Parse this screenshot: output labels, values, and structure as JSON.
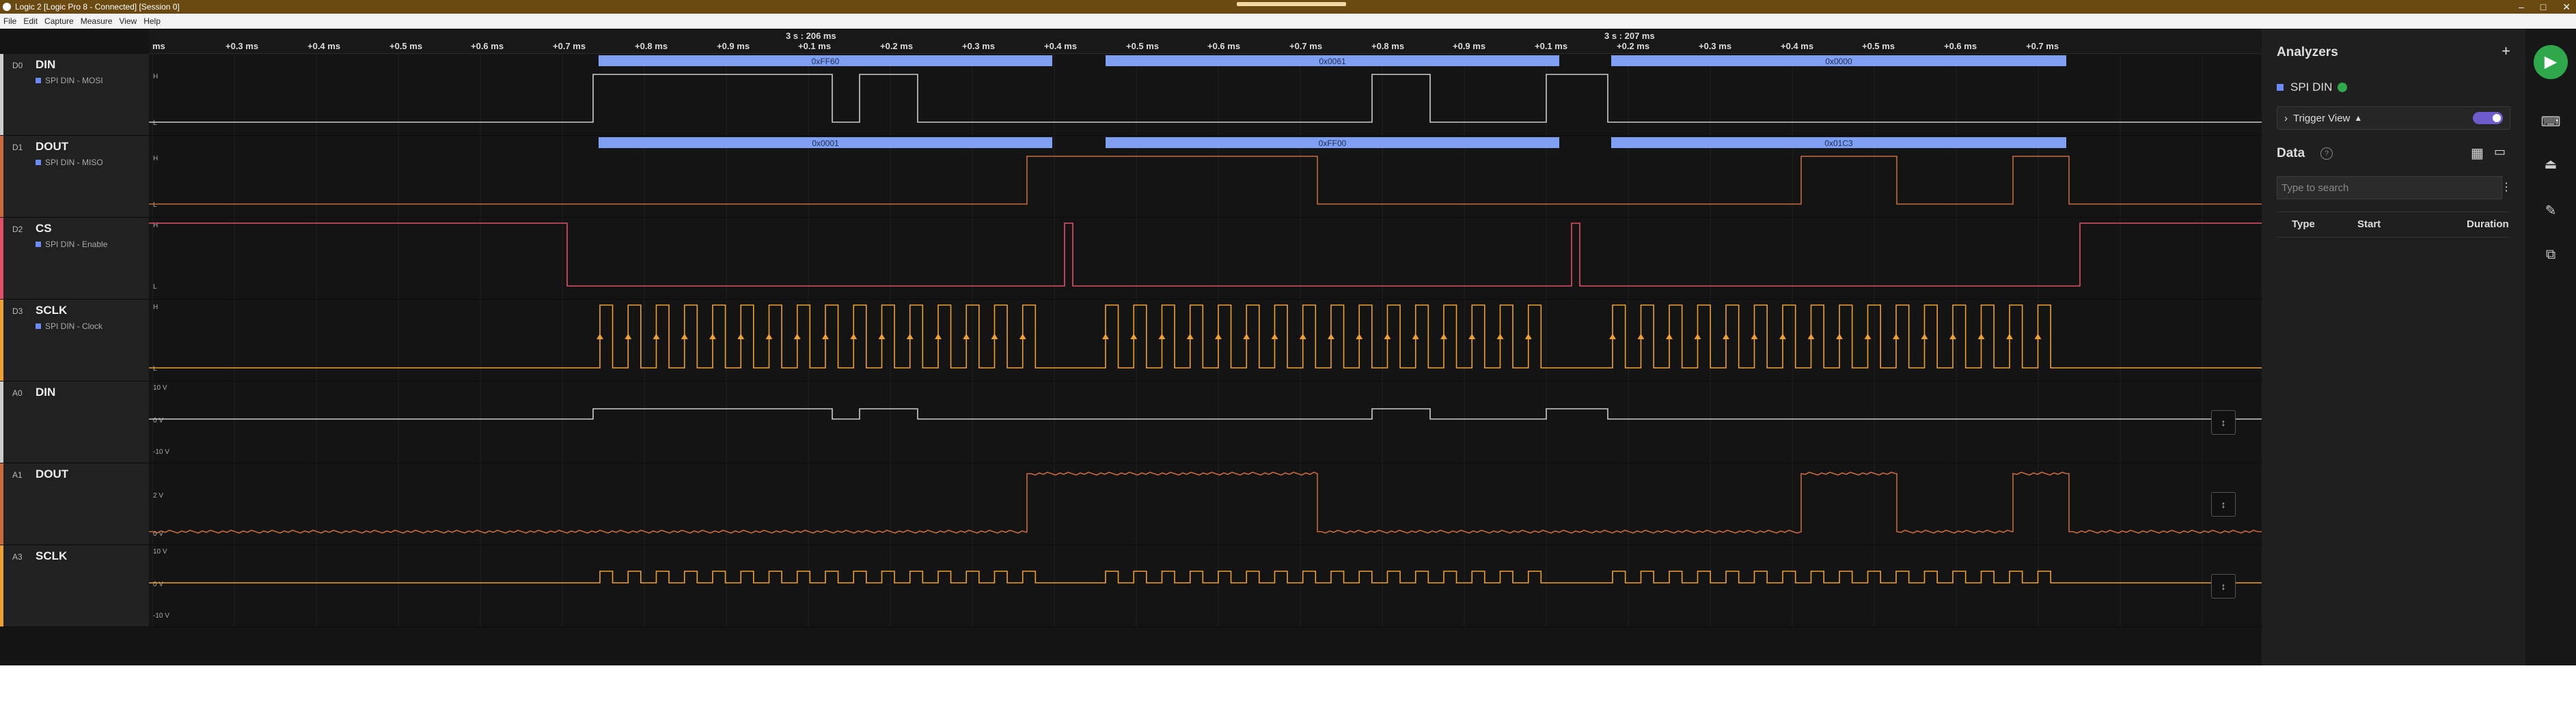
{
  "window": {
    "title": "Logic 2 [Logic Pro 8 - Connected] [Session 0]",
    "controls": [
      "–",
      "□",
      "✕"
    ]
  },
  "menu": [
    "File",
    "Edit",
    "Capture",
    "Measure",
    "View",
    "Help"
  ],
  "ruler": {
    "segment_labels": [
      "3 s : 206 ms",
      "3 s : 207 ms"
    ],
    "ticks": [
      "ms",
      "+0.3 ms",
      "+0.4 ms",
      "+0.5 ms",
      "+0.6 ms",
      "+0.7 ms",
      "+0.8 ms",
      "+0.9 ms",
      "+0.1 ms",
      "+0.2 ms",
      "+0.3 ms",
      "+0.4 ms",
      "+0.5 ms",
      "+0.6 ms",
      "+0.7 ms",
      "+0.8 ms",
      "+0.9 ms",
      "+0.1 ms",
      "+0.2 ms",
      "+0.3 ms",
      "+0.4 ms",
      "+0.5 ms",
      "+0.6 ms",
      "+0.7 ms"
    ]
  },
  "channels": [
    {
      "index": "D0",
      "name": "DIN",
      "analyzer": "SPI DIN - MOSI",
      "color": "#cccccc",
      "high": "H",
      "low": "L",
      "frames": [
        "0xFF60",
        "0x0061",
        "0x0000"
      ]
    },
    {
      "index": "D1",
      "name": "DOUT",
      "analyzer": "SPI DIN - MISO",
      "color": "#c86a3a",
      "high": "H",
      "low": "L",
      "frames": [
        "0x0001",
        "0xFF00",
        "0x01C3"
      ]
    },
    {
      "index": "D2",
      "name": "CS",
      "analyzer": "SPI DIN - Enable",
      "color": "#e0506a",
      "high": "H",
      "low": "L",
      "frames": []
    },
    {
      "index": "D3",
      "name": "SCLK",
      "analyzer": "SPI DIN - Clock",
      "color": "#f0a030",
      "high": "H",
      "low": "L",
      "frames": []
    },
    {
      "index": "A0",
      "name": "DIN",
      "analyzer": "",
      "color": "#cccccc",
      "scale": [
        "10 V",
        "0 V",
        "-10 V"
      ]
    },
    {
      "index": "A1",
      "name": "DOUT",
      "analyzer": "",
      "color": "#c86a3a",
      "scale": [
        "2 V",
        "0 V"
      ]
    },
    {
      "index": "A3",
      "name": "SCLK",
      "analyzer": "",
      "color": "#f0a030",
      "scale": [
        "10 V",
        "0 V",
        "-10 V"
      ]
    }
  ],
  "sidebar": {
    "title": "Analyzers",
    "add": "+",
    "analyzer_name": "SPI DIN",
    "trigger_view": "Trigger View",
    "data_title": "Data",
    "search_placeholder": "Type to search",
    "columns": [
      "Type",
      "Start",
      "Duration"
    ]
  },
  "rail": {
    "play": "▶",
    "icons": [
      "⌨",
      "⏏",
      "✎",
      "⧉"
    ]
  }
}
